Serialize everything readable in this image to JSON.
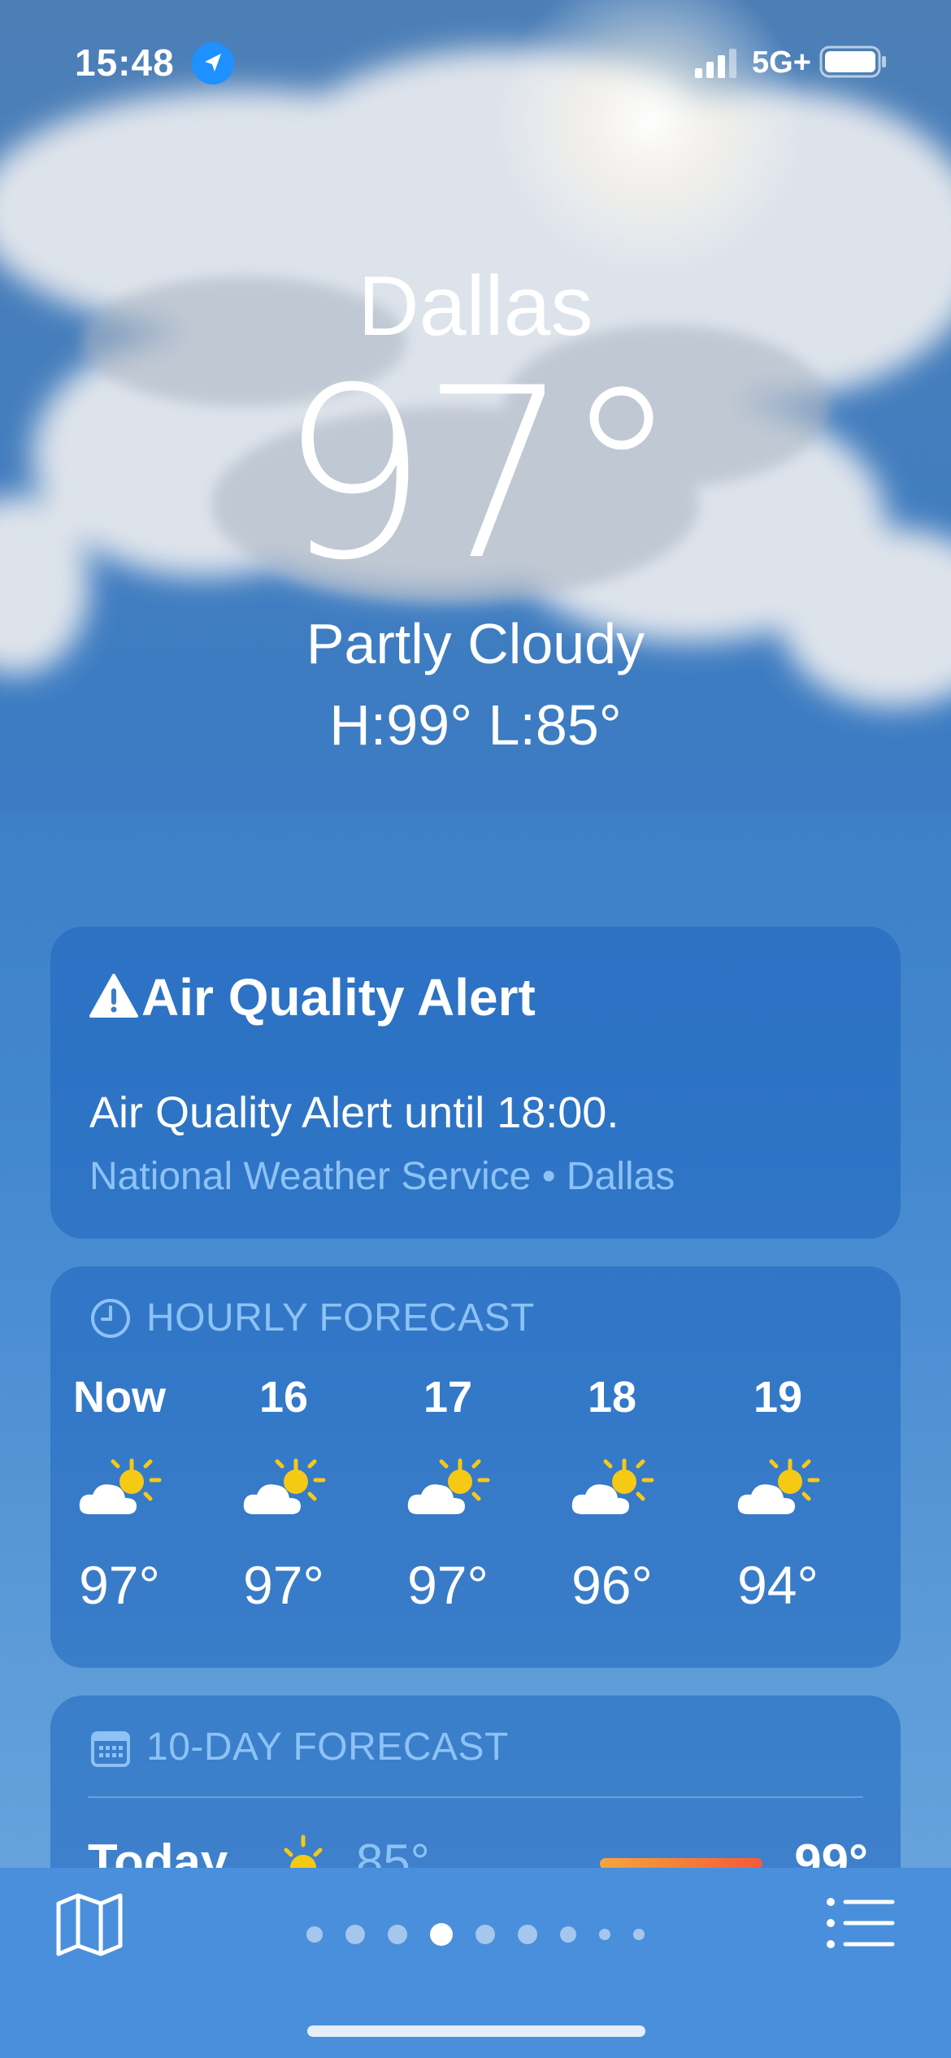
{
  "status_bar": {
    "time": "15:48",
    "network": "5G+",
    "location_icon": "location-arrow-icon"
  },
  "weather": {
    "city": "Dallas",
    "temperature": "97°",
    "condition": "Partly Cloudy",
    "high_low": "H:99°  L:85°"
  },
  "alert": {
    "title": "Air Quality Alert",
    "body": "Air Quality Alert until 18:00.",
    "source": "National Weather Service • Dallas"
  },
  "hourly": {
    "header": "HOURLY FORECAST",
    "items": [
      {
        "label": "Now",
        "icon": "partly-cloudy-sun-icon",
        "temp": "97°"
      },
      {
        "label": "16",
        "icon": "partly-cloudy-sun-icon",
        "temp": "97°"
      },
      {
        "label": "17",
        "icon": "partly-cloudy-sun-icon",
        "temp": "97°"
      },
      {
        "label": "18",
        "icon": "partly-cloudy-sun-icon",
        "temp": "96°"
      },
      {
        "label": "19",
        "icon": "partly-cloudy-sun-icon",
        "temp": "94°"
      }
    ]
  },
  "daily": {
    "header": "10-DAY FORECAST",
    "rows": [
      {
        "day": "Today",
        "icon": "sun-icon",
        "low": "85°",
        "high": "99°"
      }
    ]
  },
  "tabbar": {
    "page_count": 9,
    "active_page_index": 3
  },
  "colors": {
    "accent_text": "#8dc2f5",
    "sun": "#f6c915",
    "background": "#3b7cc4"
  }
}
